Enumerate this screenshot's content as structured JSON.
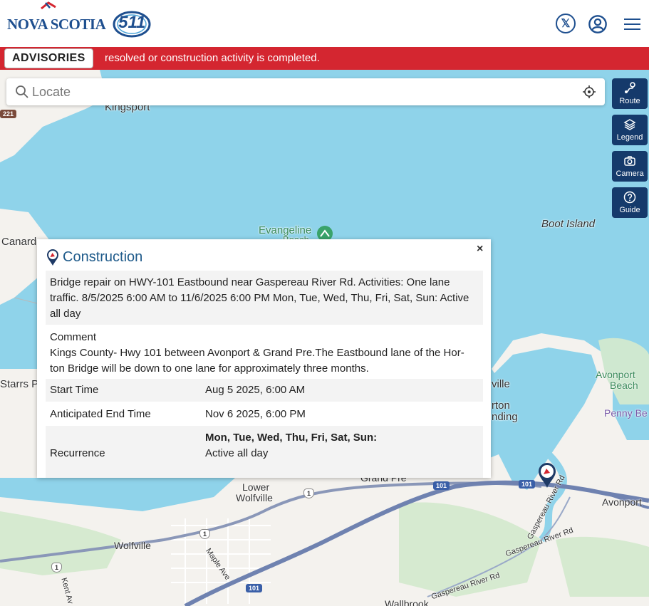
{
  "header": {
    "logo_nova": "NOVA SCOTIA",
    "logo_511": "511",
    "icons": [
      "x-social-icon",
      "user-account-icon",
      "hamburger-menu-icon"
    ]
  },
  "advisories": {
    "button_label": "ADVISORIES",
    "ticker_text": "resolved or construction activity is completed.",
    "bar_color": "#d42630"
  },
  "search": {
    "placeholder": "Locate"
  },
  "tools": [
    {
      "label": "Route",
      "icon": "route-icon"
    },
    {
      "label": "Legend",
      "icon": "layers-icon"
    },
    {
      "label": "Camera",
      "icon": "camera-icon"
    },
    {
      "label": "Guide",
      "icon": "help-icon"
    }
  ],
  "map": {
    "labels": {
      "kingsport": "Kingsport",
      "canard": "Canard",
      "evangeline": "Evangeline",
      "beach": "Beach",
      "boot_island": "Boot Island",
      "starrs_p": "Starrs P",
      "ville": "ville",
      "rton": "rton",
      "nding": "nding",
      "avonport_beach_1": "Avonport",
      "avonport_beach_2": "Beach",
      "penny_be": "Penny Be",
      "lower_wolfville_1": "Lower",
      "lower_wolfville_2": "Wolfville",
      "grand_pre": "Grand Pre",
      "avonport": "Avonport",
      "wolfville": "Wolfville",
      "maple_ave": "Maple Ave",
      "kent_ave": "Kent Av",
      "gaspereau_river_rd_1": "Gaspereau River Rd",
      "gaspereau_river_rd_2": "Gaspereau River Rd",
      "gaspereau_river_rd_3": "Gaspereau River Rd",
      "wallbrook": "Wallbrook"
    },
    "shields": {
      "r221": "221",
      "r101_a": "101",
      "r101_b": "101",
      "r101_c": "101",
      "r1_a": "1",
      "r1_b": "1",
      "r1_c": "1"
    }
  },
  "popup": {
    "title": "Construction",
    "close": "×",
    "description": "Bridge repair on HWY-101 Eastbound near Gaspereau River Rd. Activities: One lane traffic. 8/5/2025 6:00 AM to 11/6/2025 6:00 PM Mon, Tue, Wed, Thu, Fri, Sat, Sun: Active all day",
    "comment_label": "Comment",
    "comment_text": "Kings County- Hwy 101 between Avonport & Grand Pre.The Eastbound lane of the Hor-ton Bridge will be down to one lane for approximately three months.",
    "start_label": "Start Time",
    "start_value": "Aug 5 2025, 6:00 AM",
    "end_label": "Anticipated End Time",
    "end_value": "Nov 6 2025, 6:00 PM",
    "recurrence_label": "Recurrence",
    "recurrence_days": "Mon, Tue, Wed, Thu, Fri, Sat, Sun:",
    "recurrence_status": "Active all day"
  },
  "colors": {
    "brand_blue": "#1e4f8f",
    "tool_button": "#153a6b",
    "water": "#8fd3ea",
    "land": "#f4f2ee",
    "highway": "#7a8fb8",
    "marker": "#1e3a66"
  }
}
